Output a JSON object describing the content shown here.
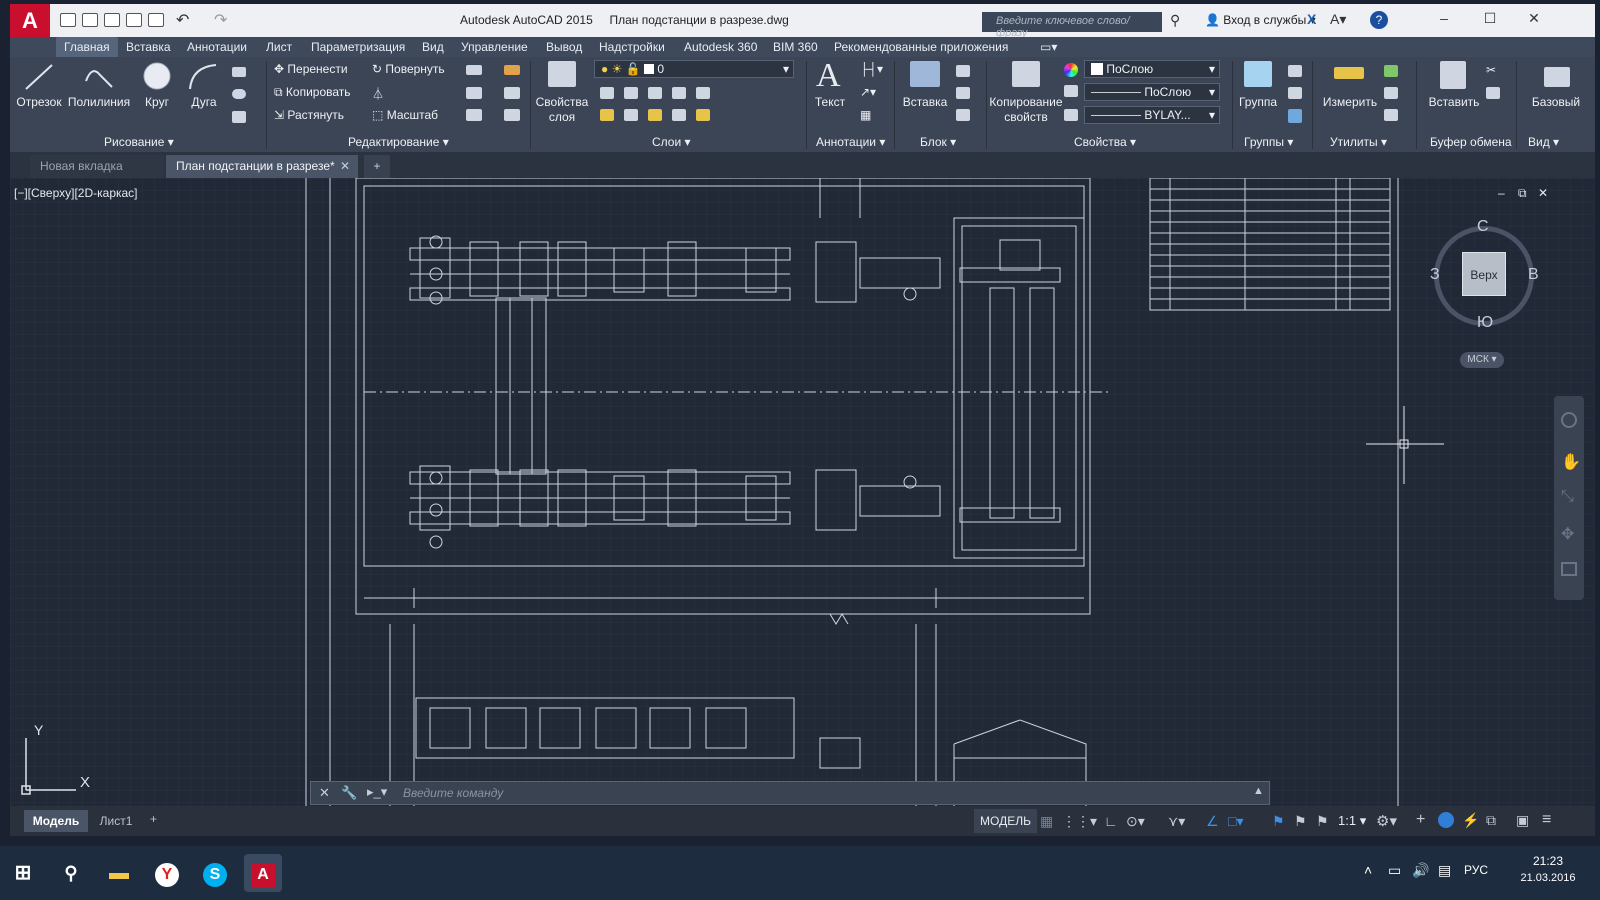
{
  "titlebar": {
    "app_title": "Autodesk AutoCAD 2015",
    "file_name": "План подстанции в разрезе.dwg",
    "search_placeholder": "Введите ключевое слово/фразу",
    "signin_label": "Вход в службы"
  },
  "ribbon_tabs": [
    "Главная",
    "Вставка",
    "Аннотации",
    "Лист",
    "Параметризация",
    "Вид",
    "Управление",
    "Вывод",
    "Надстройки",
    "Autodesk 360",
    "BIM 360",
    "Рекомендованные приложения"
  ],
  "ribbon": {
    "draw": {
      "line": "Отрезок",
      "polyline": "Полилиния",
      "circle": "Круг",
      "arc": "Дуга",
      "title": "Рисование"
    },
    "modify": {
      "move": "Перенести",
      "rotate": "Повернуть",
      "copy": "Копировать",
      "stretch": "Растянуть",
      "scale": "Масштаб",
      "title": "Редактирование"
    },
    "layers": {
      "props": "Свойства",
      "props2": "слоя",
      "current_layer": "0",
      "title": "Слои"
    },
    "annotation": {
      "text": "Текст",
      "title": "Аннотации"
    },
    "block": {
      "insert": "Вставка",
      "title": "Блок"
    },
    "properties": {
      "match": "Копирование",
      "match2": "свойств",
      "color": "ПоСлою",
      "linetype": "ПоСлою",
      "lineweight": "BYLAY...",
      "title": "Свойства"
    },
    "groups": {
      "group": "Группа",
      "title": "Группы"
    },
    "utilities": {
      "measure": "Измерить",
      "title": "Утилиты"
    },
    "clipboard": {
      "paste": "Вставить",
      "title": "Буфер обмена"
    },
    "view": {
      "base": "Базовый",
      "title": "Вид"
    }
  },
  "doc_tabs": {
    "new_tab": "Новая вкладка",
    "current": "План подстанции в разрезе*"
  },
  "viewport": {
    "label": "[−][Сверху][2D-каркас]",
    "viewcube": {
      "top": "Верх",
      "north": "С",
      "south": "Ю",
      "west": "З",
      "east": "В",
      "ucs": "МСК"
    },
    "ucs_x": "X",
    "ucs_y": "Y",
    "command_placeholder": "Введите команду"
  },
  "layout_tabs": [
    "Модель",
    "Лист1"
  ],
  "status": {
    "model": "МОДЕЛЬ",
    "scale": "1:1"
  },
  "taskbar": {
    "lang": "РУС",
    "time": "21:23",
    "date": "21.03.2016"
  }
}
